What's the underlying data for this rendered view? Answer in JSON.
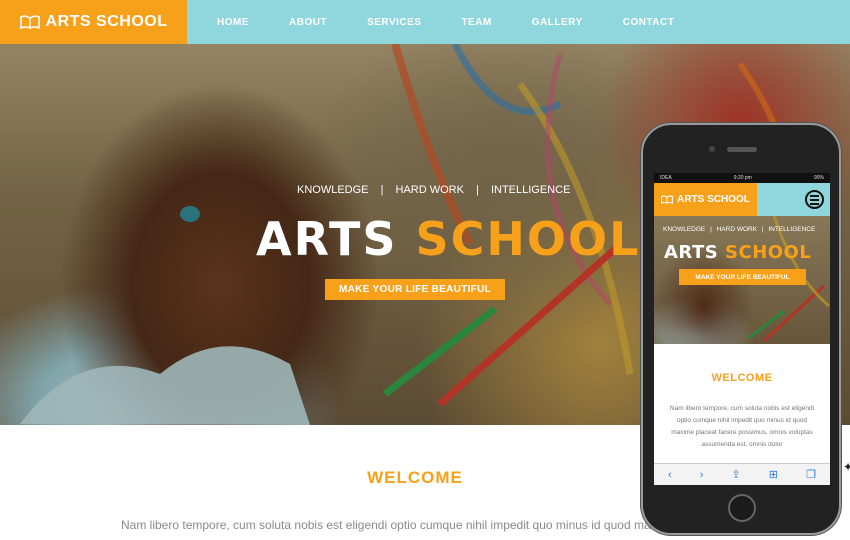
{
  "brand": {
    "name_part1": "ARTS",
    "name_part2": "SCHOOL",
    "primary_color": "#f7a11a",
    "header_color": "#8fd6dd"
  },
  "nav": {
    "items": [
      {
        "label": "HOME"
      },
      {
        "label": "ABOUT"
      },
      {
        "label": "SERVICES"
      },
      {
        "label": "TEAM"
      },
      {
        "label": "GALLERY"
      },
      {
        "label": "CONTACT"
      }
    ]
  },
  "hero": {
    "tags": [
      "KNOWLEDGE",
      "HARD WORK",
      "INTELLIGENCE"
    ],
    "separator": "|",
    "title_part1": "ARTS",
    "title_part2": "SCHOOL",
    "button_label": "MAKE YOUR LIFE BEAUTIFUL"
  },
  "welcome": {
    "heading": "WELCOME",
    "text": "Nam libero tempore, cum soluta nobis est eligendi optio cumque nihil impedit quo minus id quod maxi"
  },
  "phone": {
    "status": {
      "carrier": "IDEA",
      "time": "9:20 pm",
      "battery": "90%"
    },
    "welcome_heading": "WELCOME",
    "welcome_text": "Nam libero tempore, cum soluta nobis est eligendi optio cumque nihil impedit quo minus id quod maxime placeat facere possimus, omnis voluptas assumenda est, omnis dolor"
  }
}
